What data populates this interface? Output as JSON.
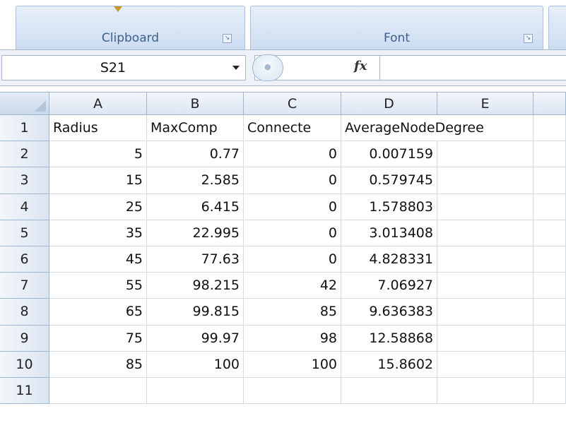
{
  "ribbon": {
    "groups": [
      {
        "label": "Clipboard"
      },
      {
        "label": "Font"
      }
    ]
  },
  "formula_bar": {
    "name_box": "S21",
    "fx_label": "fx",
    "formula": ""
  },
  "sheet": {
    "columns": [
      "A",
      "B",
      "C",
      "D",
      "E"
    ],
    "rows": [
      {
        "num": "1",
        "cells": [
          "Radius",
          "MaxComp",
          "Connecte",
          "AverageNodeDegree",
          ""
        ]
      },
      {
        "num": "2",
        "cells": [
          "5",
          "0.77",
          "0",
          "0.007159",
          ""
        ]
      },
      {
        "num": "3",
        "cells": [
          "15",
          "2.585",
          "0",
          "0.579745",
          ""
        ]
      },
      {
        "num": "4",
        "cells": [
          "25",
          "6.415",
          "0",
          "1.578803",
          ""
        ]
      },
      {
        "num": "5",
        "cells": [
          "35",
          "22.995",
          "0",
          "3.013408",
          ""
        ]
      },
      {
        "num": "6",
        "cells": [
          "45",
          "77.63",
          "0",
          "4.828331",
          ""
        ]
      },
      {
        "num": "7",
        "cells": [
          "55",
          "98.215",
          "42",
          "7.06927",
          ""
        ]
      },
      {
        "num": "8",
        "cells": [
          "65",
          "99.815",
          "85",
          "9.636383",
          ""
        ]
      },
      {
        "num": "9",
        "cells": [
          "75",
          "99.97",
          "98",
          "12.58868",
          ""
        ]
      },
      {
        "num": "10",
        "cells": [
          "85",
          "100",
          "100",
          "15.8602",
          ""
        ]
      },
      {
        "num": "11",
        "cells": [
          "",
          "",
          "",
          "",
          ""
        ]
      }
    ]
  }
}
